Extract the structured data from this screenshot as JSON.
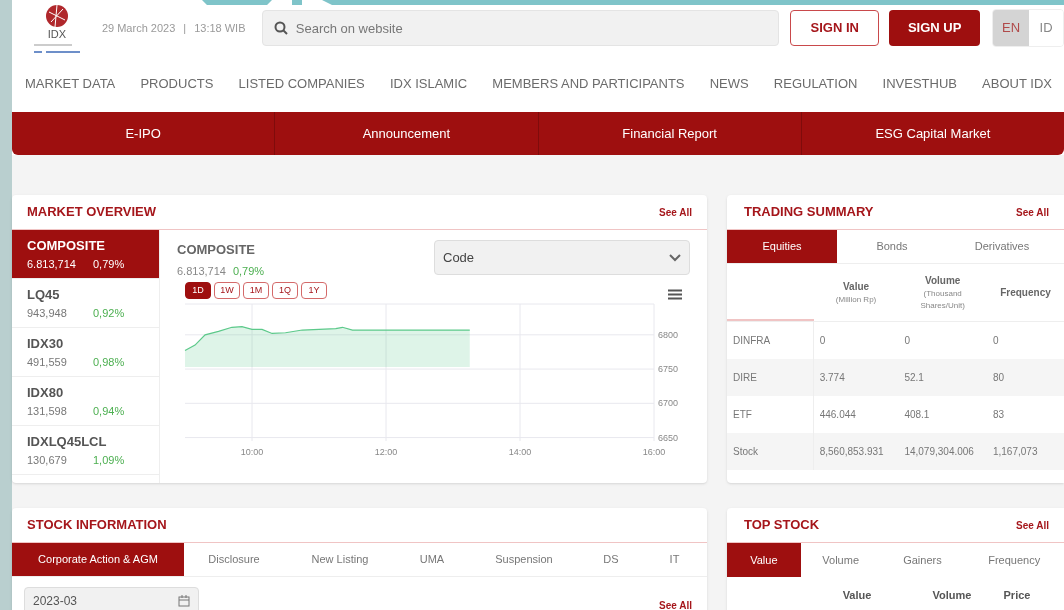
{
  "header": {
    "logo_text": "IDX",
    "date": "29 March 2023",
    "separator": "|",
    "time": "13:18 WIB",
    "search": {
      "placeholder": "Search on website"
    },
    "sign_in": "SIGN IN",
    "sign_up": "SIGN UP",
    "languages": [
      {
        "label": "EN",
        "selected": true
      },
      {
        "label": "ID",
        "selected": false
      }
    ]
  },
  "nav": [
    "MARKET DATA",
    "PRODUCTS",
    "LISTED COMPANIES",
    "IDX ISLAMIC",
    "MEMBERS AND PARTICIPANTS",
    "NEWS",
    "REGULATION",
    "INVESTHUB",
    "ABOUT IDX"
  ],
  "quick_links": [
    "E-IPO",
    "Announcement",
    "Financial Report",
    "ESG Capital Market"
  ],
  "market_overview": {
    "title": "MARKET OVERVIEW",
    "see_all": "See All",
    "indices": [
      {
        "name": "COMPOSITE",
        "value": "6.813,714",
        "change": "0,79%",
        "selected": true
      },
      {
        "name": "LQ45",
        "value": "943,948",
        "change": "0,92%",
        "selected": false
      },
      {
        "name": "IDX30",
        "value": "491,559",
        "change": "0,98%",
        "selected": false
      },
      {
        "name": "IDX80",
        "value": "131,598",
        "change": "0,94%",
        "selected": false
      },
      {
        "name": "IDXLQ45LCL",
        "value": "130,679",
        "change": "1,09%",
        "selected": false
      }
    ],
    "detail": {
      "name": "COMPOSITE",
      "value": "6.813,714",
      "change": "0,79%"
    },
    "select": {
      "value": "Code"
    },
    "periods": [
      {
        "label": "1D",
        "selected": true
      },
      {
        "label": "1W",
        "selected": false
      },
      {
        "label": "1M",
        "selected": false
      },
      {
        "label": "1Q",
        "selected": false
      },
      {
        "label": "1Y",
        "selected": false
      }
    ],
    "chart_data": {
      "type": "area",
      "x": [
        9,
        9.15,
        9.3,
        9.5,
        9.7,
        9.85,
        10,
        10.15,
        10.3,
        10.5,
        10.75,
        11,
        11.25,
        11.35,
        11.5,
        12,
        12.5,
        13,
        13.25
      ],
      "grid": true,
      "series": [
        {
          "color": "#5cc98a",
          "values": [
            6777,
            6785,
            6800,
            6805,
            6811,
            6812,
            6808,
            6808,
            6802,
            6803,
            6807,
            6808,
            6809,
            6811,
            6807,
            6807,
            6807,
            6807,
            6807
          ]
        }
      ],
      "xlim": [
        9,
        16
      ],
      "ylim": [
        6645,
        6845
      ],
      "xticks": [
        {
          "value": 10,
          "label": "10:00"
        },
        {
          "value": 12,
          "label": "12:00"
        },
        {
          "value": 14,
          "label": "14:00"
        },
        {
          "value": 16,
          "label": "16:00"
        }
      ],
      "yticks": [
        6650,
        6700,
        6750,
        6800
      ]
    }
  },
  "trading_summary": {
    "title": "TRADING SUMMARY",
    "see_all": "See All",
    "tabs": [
      {
        "label": "Equities",
        "selected": true
      },
      {
        "label": "Bonds",
        "selected": false
      },
      {
        "label": "Derivatives",
        "selected": false
      }
    ],
    "columns": [
      {
        "label": "Value",
        "sublabel": "(Million Rp)"
      },
      {
        "label": "Volume",
        "sublabel": "(Thousand Shares/Unit)"
      },
      {
        "label": "Frequency"
      }
    ],
    "rows": [
      {
        "name": "DINFRA",
        "cells": [
          "0",
          "0",
          "0"
        ]
      },
      {
        "name": "DIRE",
        "cells": [
          "3.774",
          "52.1",
          "80"
        ]
      },
      {
        "name": "ETF",
        "cells": [
          "446.044",
          "408.1",
          "83"
        ]
      },
      {
        "name": "Stock",
        "cells": [
          "8,560,853.931",
          "14,079,304.006",
          "1,167,073"
        ]
      }
    ]
  },
  "stock_information": {
    "title": "STOCK INFORMATION",
    "tabs": [
      {
        "label": "Corporate Action & AGM",
        "selected": true
      },
      {
        "label": "Disclosure",
        "selected": false
      },
      {
        "label": "New Listing",
        "selected": false
      },
      {
        "label": "UMA",
        "selected": false
      },
      {
        "label": "Suspension",
        "selected": false
      },
      {
        "label": "DS",
        "selected": false
      },
      {
        "label": "IT",
        "selected": false
      }
    ],
    "date_field": {
      "value": "2023-03"
    },
    "see_all": "See All"
  },
  "top_stock": {
    "title": "TOP STOCK",
    "see_all": "See All",
    "tabs": [
      {
        "label": "Value",
        "selected": true
      },
      {
        "label": "Volume",
        "selected": false
      },
      {
        "label": "Gainers",
        "selected": false
      },
      {
        "label": "Frequency",
        "selected": false
      }
    ],
    "columns": [
      "Value",
      "Volume",
      "Price"
    ]
  }
}
